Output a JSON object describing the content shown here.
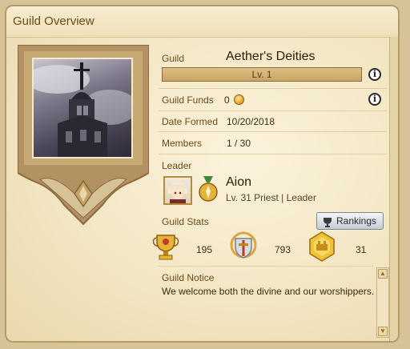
{
  "window": {
    "title": "Guild Overview"
  },
  "guild": {
    "name_label": "Guild",
    "name": "Aether's Deities",
    "level": "Lv. 1",
    "funds_label": "Guild Funds",
    "funds": "0",
    "date_label": "Date Formed",
    "date": "10/20/2018",
    "members_label": "Members",
    "members": "1 / 30"
  },
  "leader": {
    "section_label": "Leader",
    "name": "Aion",
    "details": "Lv. 31 Priest | Leader"
  },
  "stats": {
    "section_label": "Guild Stats",
    "rankings_button": "Rankings",
    "items": [
      {
        "icon": "trophy-icon",
        "value": "195"
      },
      {
        "icon": "sword-shield-icon",
        "value": "793"
      },
      {
        "icon": "guild-crest-icon",
        "value": "31"
      }
    ]
  },
  "notice": {
    "section_label": "Guild Notice",
    "text": "We welcome both the divine and our worshippers."
  },
  "colors": {
    "accent_gold": "#c9a565",
    "text_brown": "#6b4a1c",
    "panel_bg": "#f3e6c4"
  }
}
